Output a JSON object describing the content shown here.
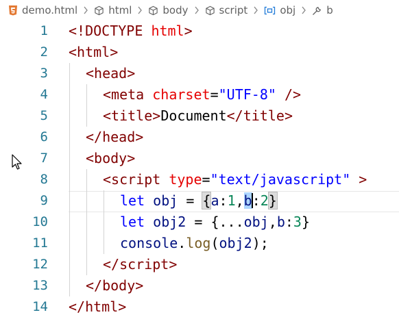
{
  "breadcrumb": {
    "items": [
      {
        "label": "demo.html",
        "icon": "html5-icon"
      },
      {
        "label": "html",
        "icon": "cube-icon"
      },
      {
        "label": "body",
        "icon": "cube-icon"
      },
      {
        "label": "script",
        "icon": "cube-icon"
      },
      {
        "label": "obj",
        "icon": "variable-icon"
      },
      {
        "label": "b",
        "icon": "wrench-icon"
      }
    ]
  },
  "colors": {
    "line_number": "#237893",
    "tag": "#800000",
    "attribute": "#e50000",
    "string": "#0000ff",
    "keyword": "#0000ff",
    "variable": "#001080",
    "function": "#795e26",
    "number": "#098658",
    "html5_orange": "#e37933",
    "variable_icon_blue": "#1f7ad8"
  },
  "editor": {
    "line_numbers": [
      "1",
      "2",
      "3",
      "4",
      "5",
      "6",
      "7",
      "8",
      "9",
      "10",
      "11",
      "12",
      "13",
      "14"
    ],
    "t": {
      "l1_open": "<!",
      "l1_doctype": "DOCTYPE",
      "l1_html": "html",
      "l1_close": ">",
      "lt": "<",
      "gt": ">",
      "lt_slash": "</",
      "html": "html",
      "head": "head",
      "body": "body",
      "meta": "meta",
      "charset": "charset",
      "eq": "=",
      "utf8": "\"UTF-8\"",
      "self_close": " />",
      "title": "title",
      "document": "Document",
      "script": "script",
      "type": "type",
      "type_val": "\"text/javascript\"",
      "space_gt": " >",
      "let": "let",
      "obj": "obj",
      "obj2": "obj2",
      "assign": " = ",
      "brace_open": "{",
      "brace_close": "}",
      "a": "a",
      "b": "b",
      "colon": ":",
      "comma": ",",
      "one": "1",
      "two": "2",
      "three": "3",
      "spread": "...",
      "console": "console",
      "dot": ".",
      "log": "log",
      "paren_open": "(",
      "paren_close": ")",
      "semi": ";",
      "space": " "
    }
  }
}
